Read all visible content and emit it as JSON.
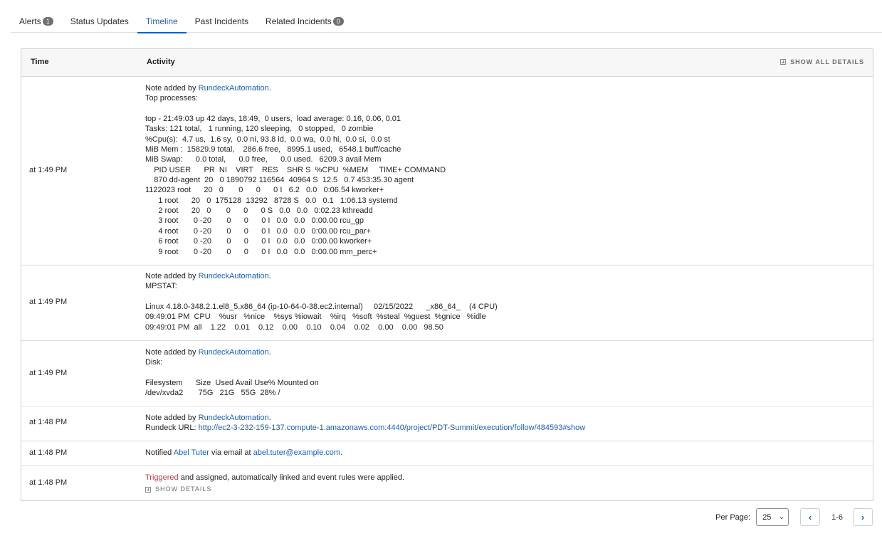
{
  "tabs": [
    {
      "label": "Alerts",
      "badge": "1"
    },
    {
      "label": "Status Updates"
    },
    {
      "label": "Timeline",
      "active": true
    },
    {
      "label": "Past Incidents"
    },
    {
      "label": "Related Incidents",
      "badge": "0"
    }
  ],
  "table": {
    "col_time": "Time",
    "col_activity": "Activity",
    "show_all_details": "SHOW ALL DETAILS"
  },
  "entries": [
    {
      "time": "at 1:49 PM",
      "prefix": "Note added by ",
      "author": "RundeckAutomation",
      "suffix": ".",
      "lines": [
        "Top processes:",
        "",
        "top - 21:49:03 up 42 days, 18:49,  0 users,  load average: 0.16, 0.06, 0.01",
        "Tasks: 121 total,   1 running, 120 sleeping,   0 stopped,   0 zombie",
        "%Cpu(s):  4.7 us,  1.6 sy,  0.0 ni, 93.8 id,  0.0 wa,  0.0 hi,  0.0 si,  0.0 st",
        "MiB Mem :  15829.9 total,    286.6 free,   8995.1 used,   6548.1 buff/cache",
        "MiB Swap:      0.0 total,      0.0 free,      0.0 used.   6209.3 avail Mem",
        "    PID USER      PR  NI    VIRT    RES    SHR S  %CPU  %MEM     TIME+ COMMAND",
        "    870 dd-agent  20   0 1890792 116564  40964 S  12.5   0.7 453:35.30 agent",
        "1122023 root      20   0       0      0      0 I   6.2   0.0   0:06.54 kworker+",
        "      1 root      20   0  175128  13292   8728 S   0.0   0.1   1:06.13 systemd",
        "      2 root      20   0       0      0      0 S   0.0   0.0   0:02.23 kthreadd",
        "      3 root       0 -20       0      0      0 I   0.0   0.0   0:00.00 rcu_gp",
        "      4 root       0 -20       0      0      0 I   0.0   0.0   0:00.00 rcu_par+",
        "      6 root       0 -20       0      0      0 I   0.0   0.0   0:00.00 kworker+",
        "      9 root       0 -20       0      0      0 I   0.0   0.0   0:00.00 mm_perc+"
      ]
    },
    {
      "time": "at 1:49 PM",
      "prefix": "Note added by ",
      "author": "RundeckAutomation",
      "suffix": ".",
      "lines": [
        "MPSTAT:",
        "",
        "Linux 4.18.0-348.2.1.el8_5.x86_64 (ip-10-64-0-38.ec2.internal)     02/15/2022      _x86_64_    (4 CPU)",
        "09:49:01 PM  CPU    %usr   %nice    %sys %iowait    %irq   %soft  %steal  %guest  %gnice   %idle",
        "09:49:01 PM  all    1.22    0.01    0.12    0.00    0.10    0.04    0.02    0.00    0.00   98.50"
      ]
    },
    {
      "time": "at 1:49 PM",
      "prefix": "Note added by ",
      "author": "RundeckAutomation",
      "suffix": ".",
      "lines": [
        "Disk:",
        "",
        "Filesystem      Size  Used Avail Use% Mounted on",
        "/dev/xvda2       75G   21G   55G  28% /"
      ]
    },
    {
      "time": "at 1:48 PM",
      "prefix": "Note added by ",
      "author": "RundeckAutomation",
      "suffix": ".",
      "url_label": "Rundeck URL: ",
      "url": "http://ec2-3-232-159-137.compute-1.amazonaws.com:4440/project/PDT-Summit/execution/follow/484593#show"
    },
    {
      "time": "at 1:48 PM",
      "notified_prefix": "Notified ",
      "notified_name": "Abel Tuter",
      "notified_mid": " via email at ",
      "notified_email": "abel.tuter@example.com",
      "notified_suffix": "."
    },
    {
      "time": "at 1:48 PM",
      "triggered": "Triggered",
      "triggered_rest": " and assigned, automatically linked and event rules were applied.",
      "show_details": "SHOW DETAILS"
    }
  ],
  "pagination": {
    "per_page_label": "Per Page:",
    "per_page_value": "25",
    "range": "1-6"
  }
}
